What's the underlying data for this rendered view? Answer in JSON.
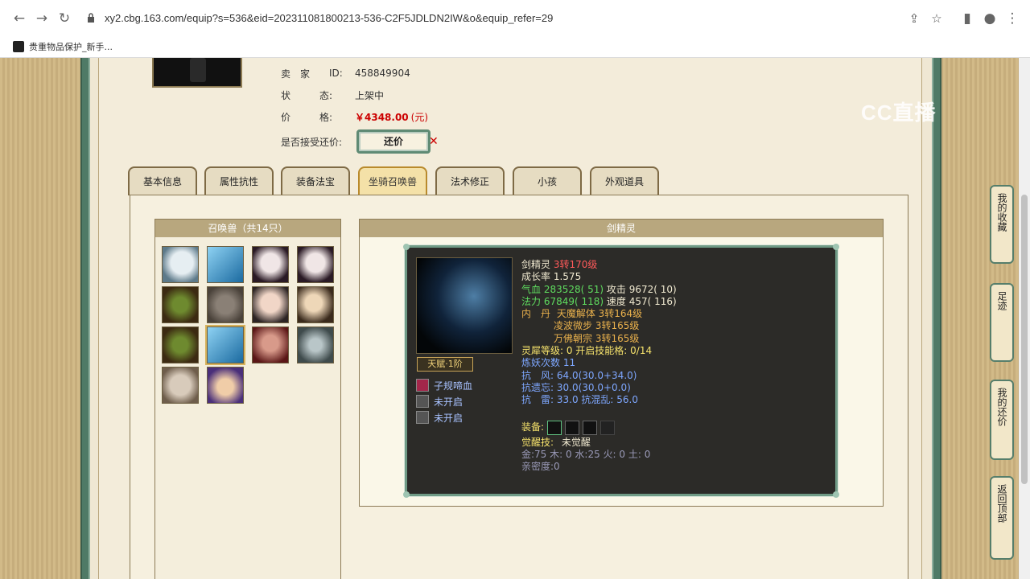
{
  "browser": {
    "url": "xy2.cbg.163.com/equip?s=536&eid=202311081800213-536-C2F5JDLDN2IW&o&equip_refer=29",
    "bookmark": "贵重物品保护_新手..."
  },
  "watermark": "CC直播",
  "seller": {
    "seller_label": "卖　家",
    "id_label": "ID:",
    "id": "458849904",
    "status_label": "状　　　态:",
    "status": "上架中",
    "price_label": "价　　　格:",
    "price": "￥4348.00",
    "price_unit": "(元)",
    "counter_label": "是否接受还价:",
    "counter_button": "还价"
  },
  "tabs": [
    "基本信息",
    "属性抗性",
    "装备法宝",
    "坐骑召唤兽",
    "法术修正",
    "小孩",
    "外观道具"
  ],
  "active_tab": "坐骑召唤兽",
  "pet_list": {
    "title": "召唤兽（共14只）",
    "count": 14
  },
  "detail": {
    "title": "剑精灵",
    "name": "剑精灵",
    "level": "3转170级",
    "growth_label": "成长率",
    "growth": "1.575",
    "hp": "气血 283528( 51)",
    "atk": "攻击 9672( 10)",
    "mp": "法力 67849( 118)",
    "speed": "速度 457( 116)",
    "dan_label": "内　丹",
    "dan1": "天魔解体 3转164级",
    "dan2": "凌波微步 3转165级",
    "dan3": "万佛朝宗 3转165级",
    "lingxi": "灵犀等级:  0 开启技能格:  0/14",
    "lianyao": "炼妖次数 11",
    "res_feng_label": "抗　风:",
    "res_feng": "64.0(30.0+34.0)",
    "res_yiwang_label": "抗遗忘:",
    "res_yiwang": "30.0(30.0+0.0)",
    "res_lei_label": "抗　雷:",
    "res_lei": "33.0",
    "res_hunluan": "抗混乱: 56.0",
    "equip_label": "装备:",
    "awaken_label": "觉醒技:",
    "awaken": "未觉醒",
    "elements": "金:75 木: 0 水:25 火: 0 土: 0",
    "intimacy": "亲密度:0",
    "talent": "天赋·1阶",
    "skills": [
      "子规啼血",
      "未开启",
      "未开启"
    ]
  },
  "floating": {
    "fav": "我的收藏",
    "footprint": "足迹",
    "mybargain": "我的还价",
    "top": "返回顶部"
  }
}
